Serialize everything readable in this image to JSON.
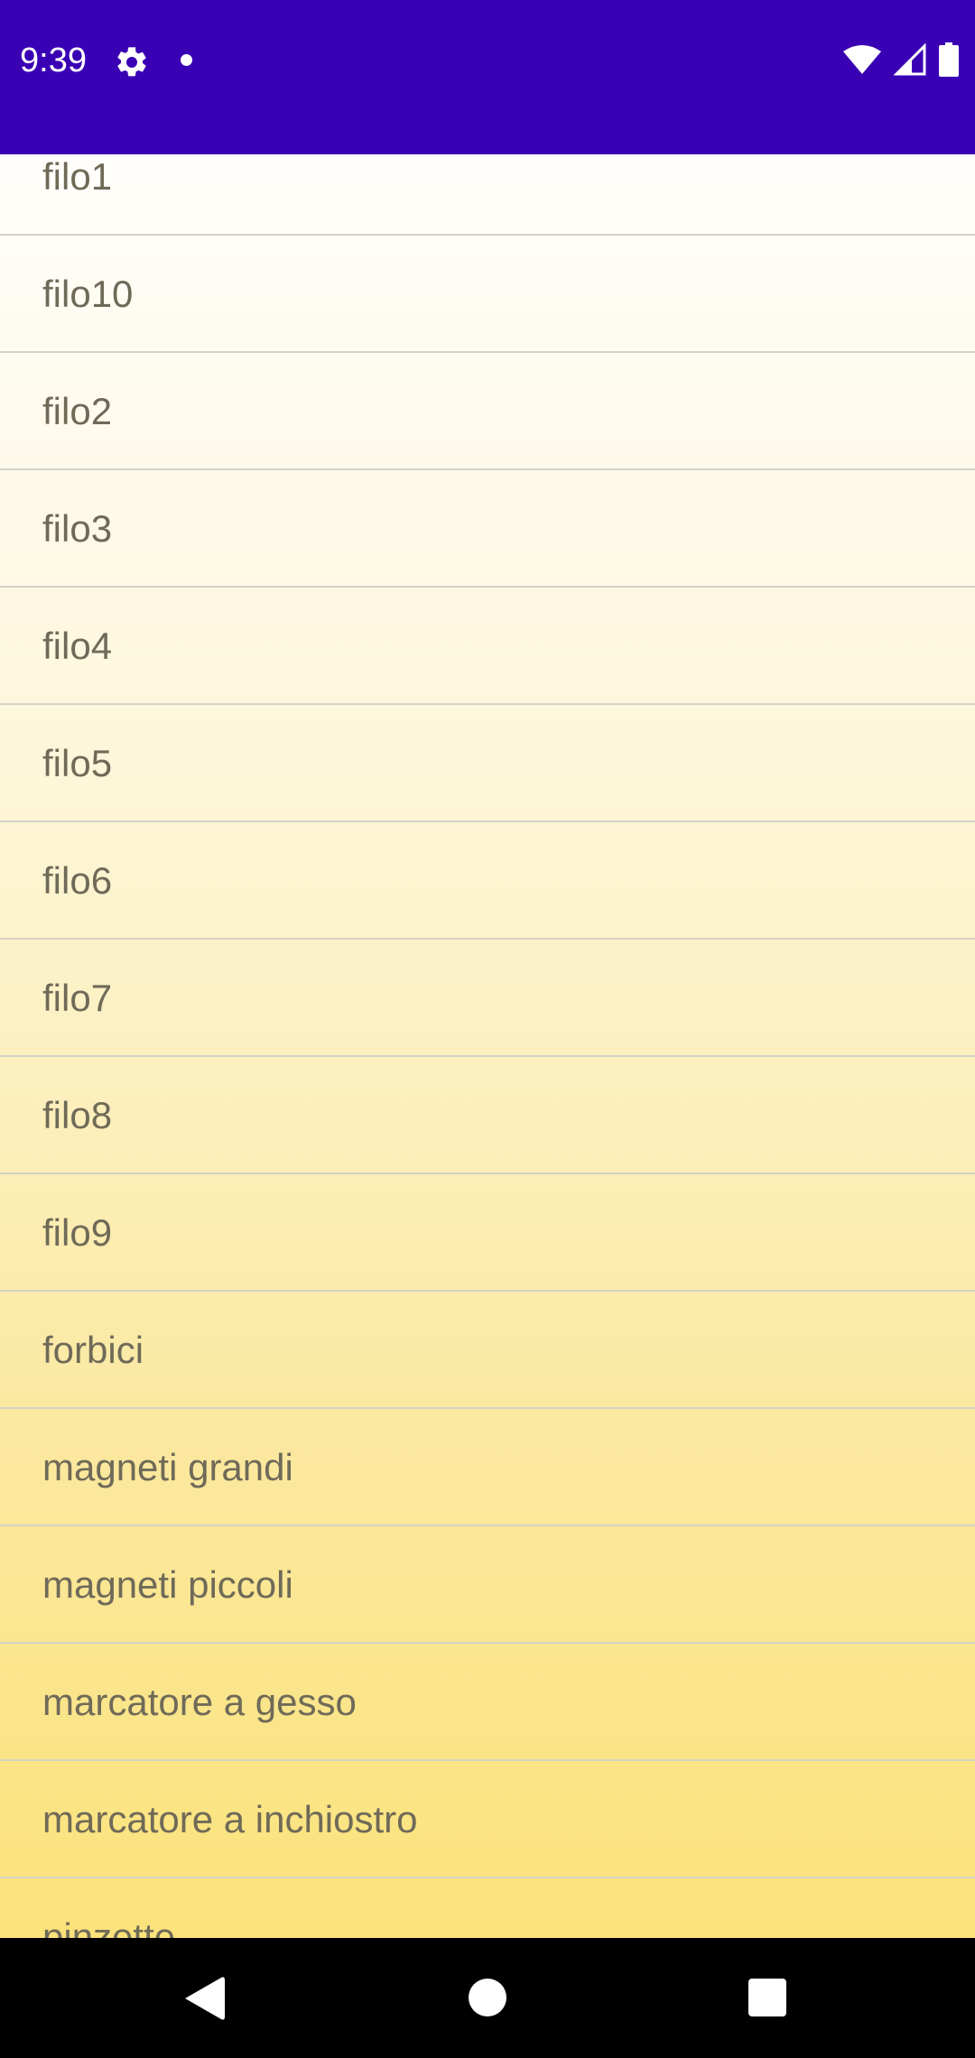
{
  "status_bar": {
    "time": "9:39",
    "background_color": "#3a00b4",
    "icons": [
      "gear-icon",
      "notification-dot-icon",
      "wifi-icon",
      "cellular-signal-icon",
      "battery-icon"
    ]
  },
  "list": {
    "items": [
      {
        "label": "filo1"
      },
      {
        "label": "filo10"
      },
      {
        "label": "filo2"
      },
      {
        "label": "filo3"
      },
      {
        "label": "filo4"
      },
      {
        "label": "filo5"
      },
      {
        "label": "filo6"
      },
      {
        "label": "filo7"
      },
      {
        "label": "filo8"
      },
      {
        "label": "filo9"
      },
      {
        "label": "forbici"
      },
      {
        "label": "magneti grandi"
      },
      {
        "label": "magneti piccoli"
      },
      {
        "label": "marcatore a gesso"
      },
      {
        "label": "marcatore a inchiostro"
      },
      {
        "label": "pinzette"
      }
    ]
  },
  "nav_bar": {
    "icons": [
      "back-icon",
      "home-icon",
      "recents-icon"
    ]
  }
}
